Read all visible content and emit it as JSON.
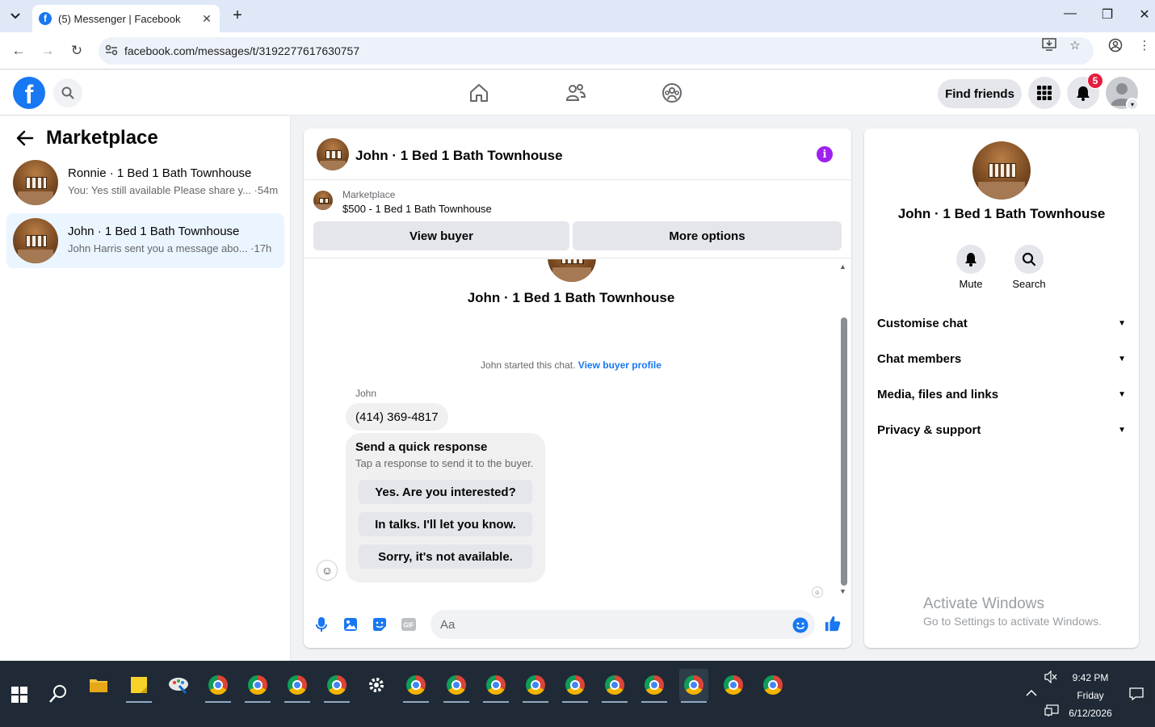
{
  "browser": {
    "tab_title": "(5) Messenger | Facebook",
    "tab_favicon": "f",
    "url": "facebook.com/messages/t/3192277617630757"
  },
  "fb_nav": {
    "logo_letter": "f",
    "find_friends": "Find friends",
    "notification_count": "5"
  },
  "left_panel": {
    "title": "Marketplace",
    "conversations": [
      {
        "name": "Ronnie · 1 Bed 1 Bath Townhouse",
        "snippet": "You: Yes still available Please share y... ·54m",
        "active": false
      },
      {
        "name": "John · 1 Bed 1 Bath Townhouse",
        "snippet": "John Harris sent you a message abo... ·17h",
        "active": true
      }
    ]
  },
  "chat": {
    "header_name": "John · 1 Bed 1 Bath Townhouse",
    "info_icon": "i",
    "listing_source": "Marketplace",
    "listing_price": "$500 - 1 Bed 1 Bath Townhouse",
    "view_buyer": "View buyer",
    "more_options": "More options",
    "convo_title": "John · 1 Bed 1 Bath Townhouse",
    "started_text": "John started this chat.",
    "started_link": "View buyer profile",
    "sender": "John",
    "phone": "(414) 369-4817",
    "quick_title": "Send a quick response",
    "quick_sub": "Tap a response to send it to the buyer.",
    "quick_replies": [
      "Yes. Are you interested?",
      "In talks. I'll let you know.",
      "Sorry, it's not available."
    ],
    "composer_placeholder": "Aa"
  },
  "right_panel": {
    "name": "John · 1 Bed 1 Bath Townhouse",
    "actions": [
      {
        "label": "Mute",
        "icon": "bell-icon"
      },
      {
        "label": "Search",
        "icon": "search-icon"
      }
    ],
    "sections": [
      "Customise chat",
      "Chat members",
      "Media, files and links",
      "Privacy & support"
    ]
  },
  "watermark": {
    "line1": "Activate Windows",
    "line2": "Go to Settings to activate Windows."
  },
  "taskbar": {
    "time": "9:42 PM",
    "day": "Friday",
    "date": "6/12/2026"
  },
  "colors": {
    "fb_blue": "#1877f2",
    "badge_red": "#e41e3f",
    "info_purple": "#a020f0",
    "active_conv": "#ebf5ff"
  }
}
